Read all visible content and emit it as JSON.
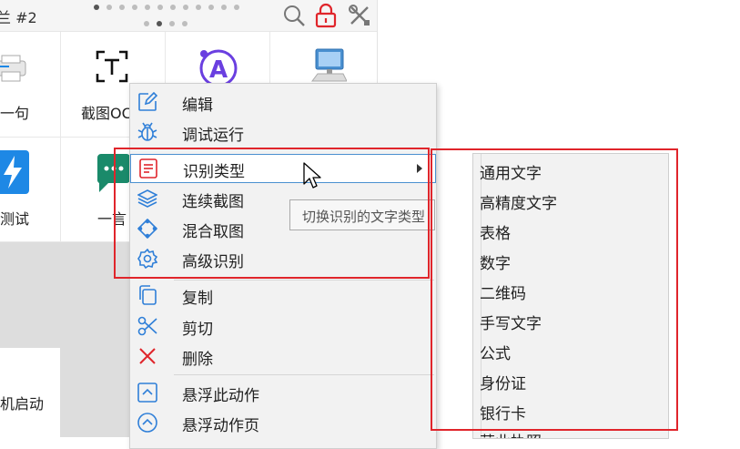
{
  "window": {
    "title_fragment": "兰 #2"
  },
  "toolbar": {
    "search_icon": "search-icon",
    "lock_icon": "lock-icon",
    "tools_icon": "tools-icon"
  },
  "tiles": {
    "row1": [
      {
        "label": "一句",
        "icon": "printer-icon"
      },
      {
        "label": "截图OC",
        "icon": "text-capture-icon"
      },
      {
        "label": "",
        "icon": "a-circle-icon"
      },
      {
        "label": "",
        "icon": "computer-icon"
      }
    ],
    "row2": [
      {
        "label": "测试",
        "icon": "lightning-icon"
      },
      {
        "label": "一言",
        "icon": "chat-icon"
      }
    ],
    "row3": [
      {
        "label": "机启动",
        "icon": ""
      }
    ]
  },
  "menu": {
    "items": [
      {
        "label": "编辑",
        "icon": "edit-icon"
      },
      {
        "label": "调试运行",
        "icon": "bug-icon"
      },
      {
        "label": "识别类型",
        "icon": "document-list-icon"
      },
      {
        "label": "连续截图",
        "icon": "layers-icon"
      },
      {
        "label": "混合取图",
        "icon": "diamond-arrows-icon"
      },
      {
        "label": "高级识别",
        "icon": "gear-icon"
      },
      {
        "label": "复制",
        "icon": "copy-icon"
      },
      {
        "label": "剪切",
        "icon": "scissors-icon"
      },
      {
        "label": "删除",
        "icon": "close-icon"
      },
      {
        "label": "悬浮此动作",
        "icon": "chevron-up-square-icon"
      },
      {
        "label": "悬浮动作页",
        "icon": "chevron-up-circle-icon"
      }
    ]
  },
  "tooltip": {
    "text": "切换识别的文字类型"
  },
  "submenu": {
    "items": [
      "通用文字",
      "高精度文字",
      "表格",
      "数字",
      "二维码",
      "手写文字",
      "公式",
      "身份证",
      "银行卡",
      "营业执照"
    ]
  },
  "colors": {
    "accent": "#2f7fd8",
    "highlight_border": "#e0252b",
    "delete_red": "#e0252b",
    "purple": "#6a3fe0",
    "teal": "#1a8a6a",
    "lightning_blue": "#1e88e5"
  }
}
